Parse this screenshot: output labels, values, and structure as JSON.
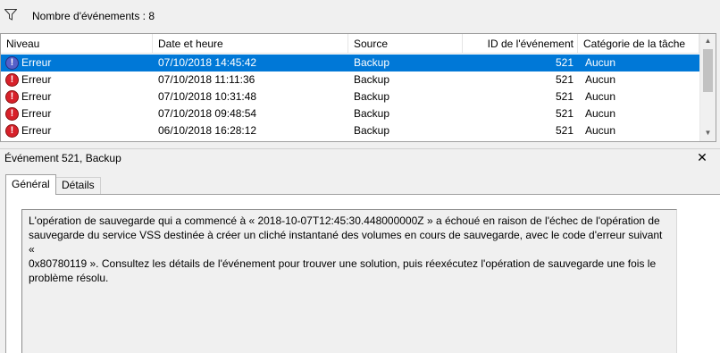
{
  "filter": {
    "icon": "funnel-icon",
    "event_count": "Nombre d'événements : 8"
  },
  "columns": [
    "Niveau",
    "Date et heure",
    "Source",
    "ID de l'événement",
    "Catégorie de la tâche"
  ],
  "events": [
    {
      "level": "Erreur",
      "datetime": "07/10/2018 14:45:42",
      "source": "Backup",
      "id": "521",
      "category": "Aucun",
      "selected": true
    },
    {
      "level": "Erreur",
      "datetime": "07/10/2018 11:11:36",
      "source": "Backup",
      "id": "521",
      "category": "Aucun",
      "selected": false
    },
    {
      "level": "Erreur",
      "datetime": "07/10/2018 10:31:48",
      "source": "Backup",
      "id": "521",
      "category": "Aucun",
      "selected": false
    },
    {
      "level": "Erreur",
      "datetime": "07/10/2018 09:48:54",
      "source": "Backup",
      "id": "521",
      "category": "Aucun",
      "selected": false
    },
    {
      "level": "Erreur",
      "datetime": "06/10/2018 16:28:12",
      "source": "Backup",
      "id": "521",
      "category": "Aucun",
      "selected": false
    }
  ],
  "details": {
    "title": "Événement 521, Backup",
    "close_glyph": "✕",
    "tabs": [
      "Général",
      "Détails"
    ],
    "active_tab": "Général",
    "message": "L'opération de sauvegarde qui a commencé à « 2018-10-07T12:45:30.448000000Z » a échoué en raison de l'échec de l'opération de\nsauvegarde du service VSS destinée à créer un cliché instantané des volumes en cours de sauvegarde, avec le code d'erreur suivant «\n0x80780119 ». Consultez les détails de l'événement pour trouver une solution, puis réexécutez l'opération de sauvegarde une fois le\nproblème résolu."
  },
  "colors": {
    "selection": "#0078d7",
    "error_icon": "#d7212a"
  }
}
